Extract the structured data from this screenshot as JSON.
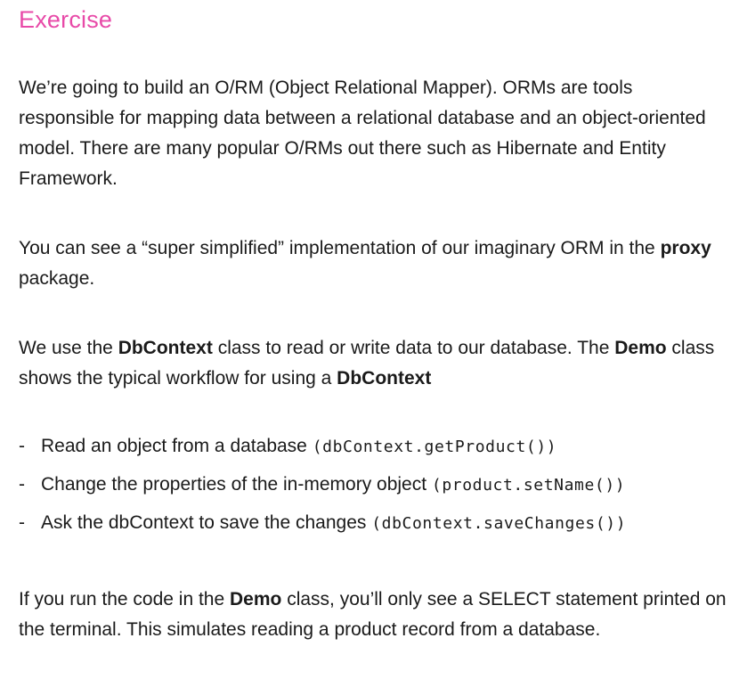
{
  "title": "Exercise",
  "p1": "We’re going to build an O/RM (Object Relational Mapper). ORMs are tools responsible for mapping data between a relational database and an object-oriented model. There are many popular O/RMs out there such as Hibernate and Entity Framework.",
  "p2": {
    "a": "You can see a “super simplified” implementation of our imaginary ORM in the ",
    "b": "proxy",
    "c": " package."
  },
  "p3": {
    "a": "We use the ",
    "b": "DbContext",
    "c": " class to read or write data to our database. The ",
    "d": "Demo",
    "e": " class shows the typical workflow for using a ",
    "f": "DbContext"
  },
  "bullets": [
    {
      "dash": "-",
      "text": "Read an object from a database ",
      "code": "(dbContext.getProduct())"
    },
    {
      "dash": "-",
      "text": "Change the properties of the in-memory object ",
      "code": "(product.setName())"
    },
    {
      "dash": "-",
      "text": "Ask the dbContext to save the changes ",
      "code": "(dbContext.saveChanges())"
    }
  ],
  "p5": {
    "a": "If you run the code in the ",
    "b": "Demo",
    "c": " class, you’ll only see a SELECT statement printed on the terminal. This simulates reading a product record from a database."
  },
  "colors": {
    "title": "#e84aa8",
    "text": "#1a1a1a"
  }
}
